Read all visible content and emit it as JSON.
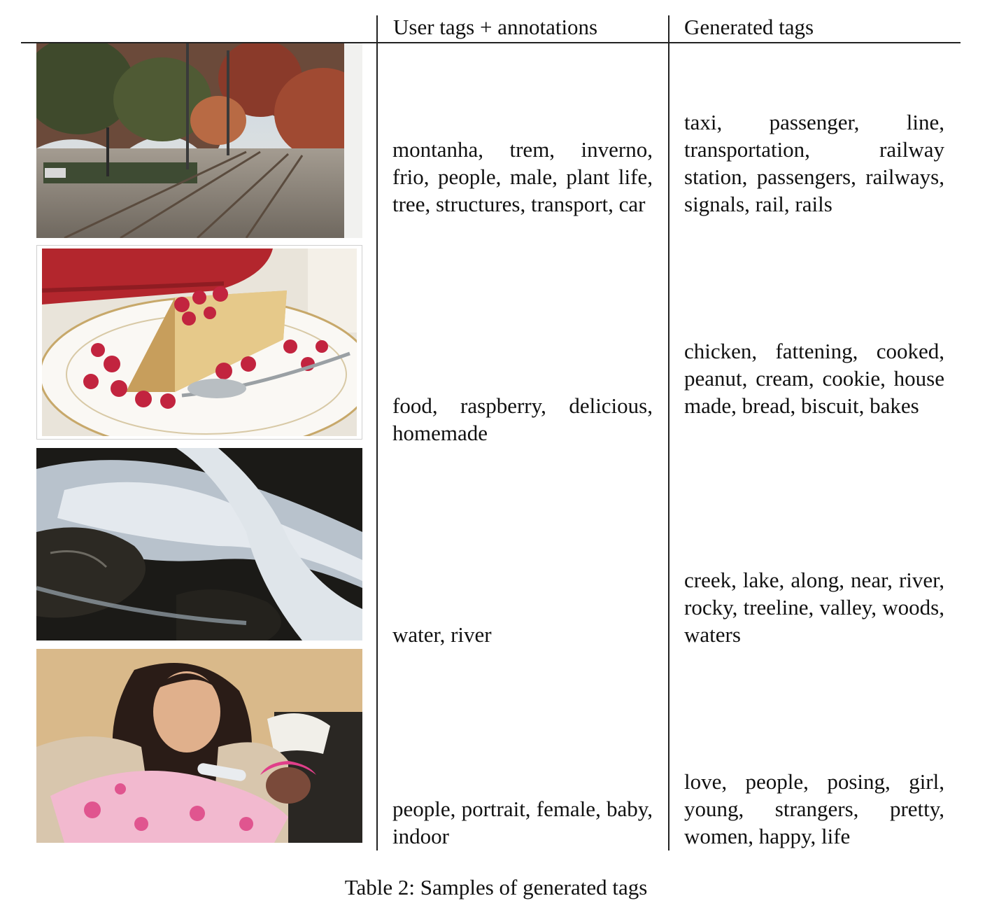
{
  "table": {
    "headers": {
      "user_tags": "User tags + annotations",
      "generated_tags": "Generated tags"
    },
    "rows": [
      {
        "image": "railway tracks with autumn trees",
        "user_tags": "montanha, trem, inverno, frio, people, male, plant life, tree, structures, trans­port, car",
        "generated_tags": "taxi, passenger, line, transportation, railway station, passengers, railways, signals, rail, rails"
      },
      {
        "image": "slice of raspberry cake on a plate",
        "user_tags": "food, raspberry, delicious, homemade",
        "generated_tags": "chicken, fattening, cooked, peanut, cream, cookie, house made, bread, biscuit, bakes"
      },
      {
        "image": "water flowing over rocks",
        "user_tags": "water, river",
        "generated_tags": "creek, lake, along, near, river, rocky, treeline, val­ley, woods, waters"
      },
      {
        "image": "woman feeding a baby with a bottle",
        "user_tags": "people, portrait, female, baby, indoor",
        "generated_tags": "love, people, posing, girl, young, strangers, pretty, women, happy, life"
      }
    ]
  },
  "caption": "Table 2: Samples of generated tags",
  "colors": {
    "rule": "#222222",
    "text": "#111111"
  }
}
